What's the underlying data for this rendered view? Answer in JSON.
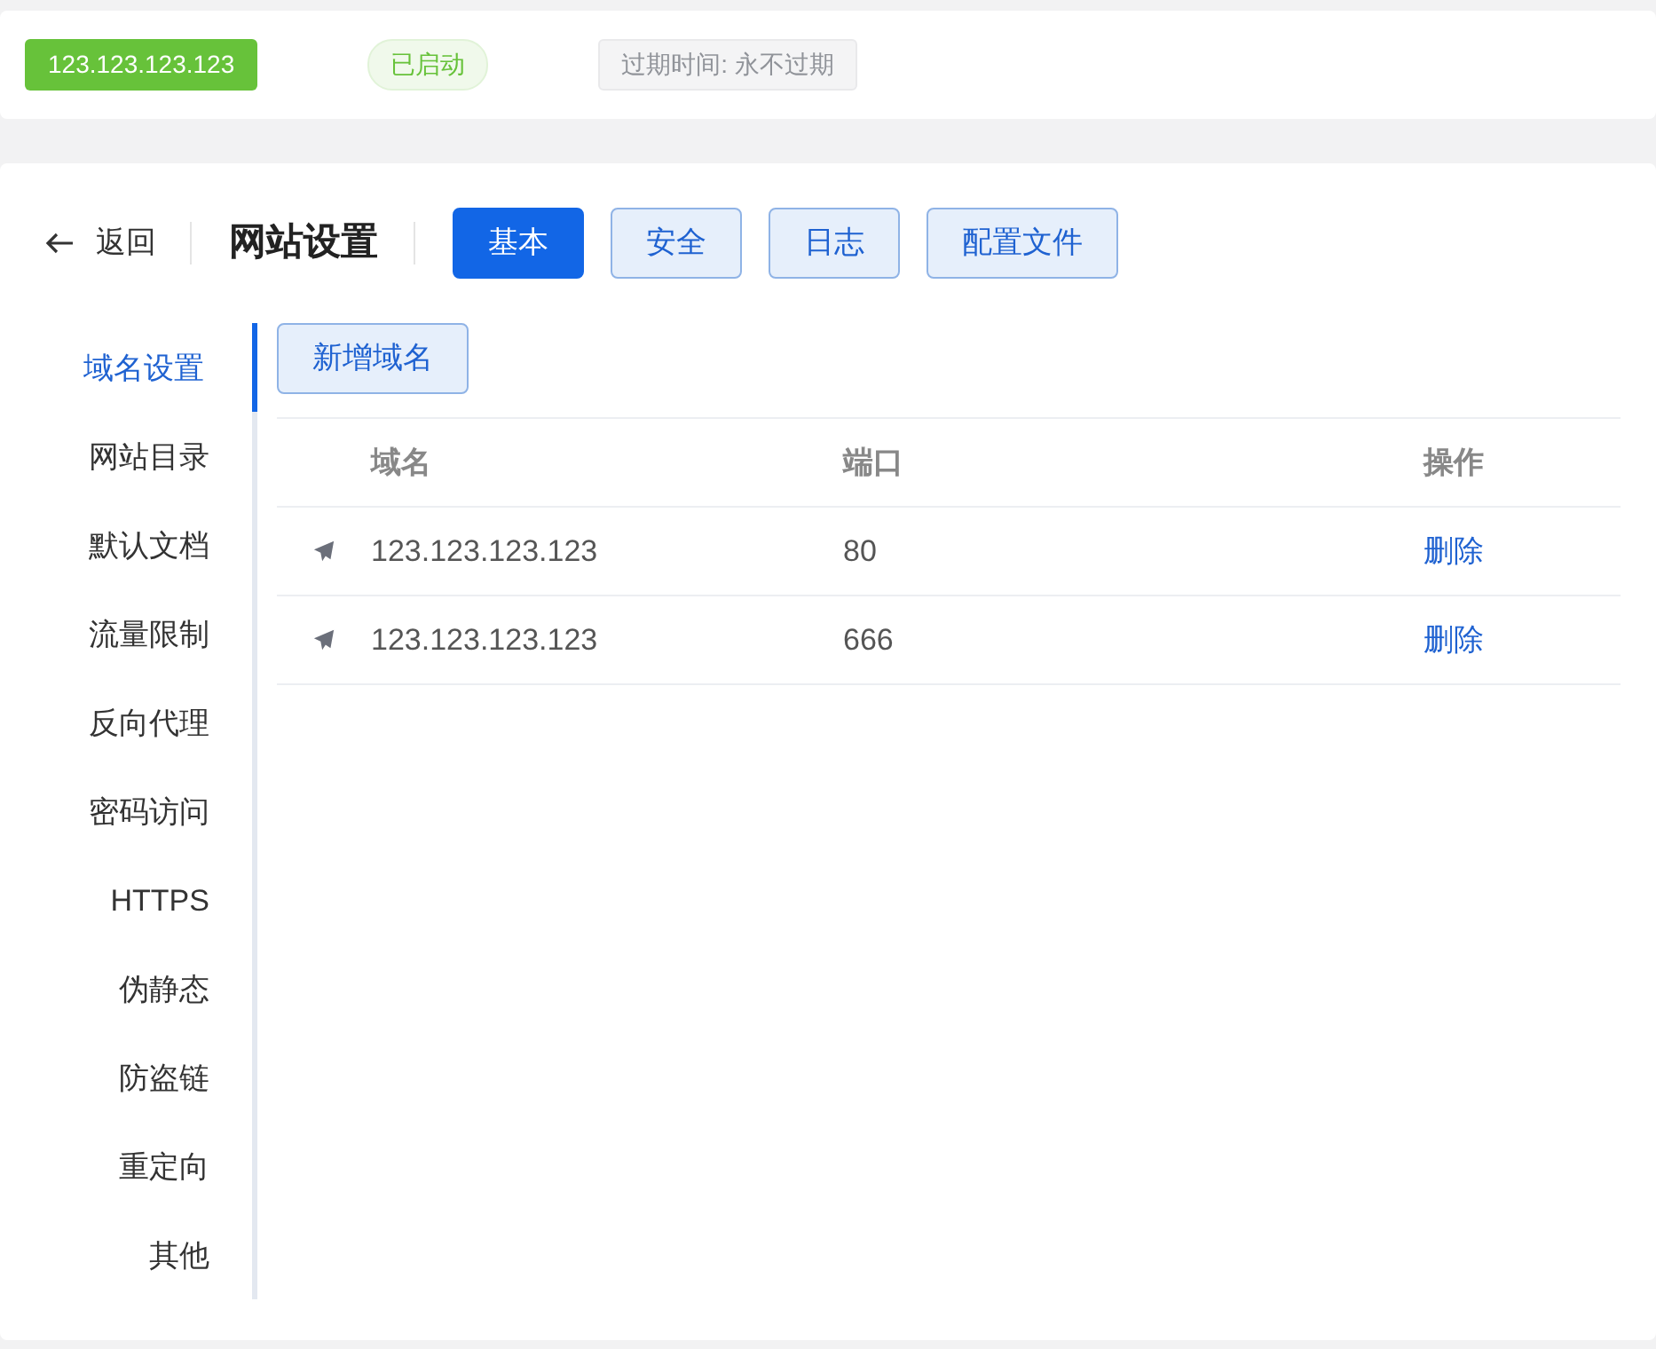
{
  "site_info": {
    "address": "123.123.123.123",
    "status": "已启动",
    "expiry": "过期时间: 永不过期"
  },
  "header": {
    "back": "返回",
    "title": "网站设置",
    "tabs": [
      {
        "label": "基本",
        "selected": true
      },
      {
        "label": "安全",
        "selected": false
      },
      {
        "label": "日志",
        "selected": false
      },
      {
        "label": "配置文件",
        "selected": false
      }
    ]
  },
  "sidebar": {
    "items": [
      {
        "label": "域名设置",
        "selected": true
      },
      {
        "label": "网站目录",
        "selected": false
      },
      {
        "label": "默认文档",
        "selected": false
      },
      {
        "label": "流量限制",
        "selected": false
      },
      {
        "label": "反向代理",
        "selected": false
      },
      {
        "label": "密码访问",
        "selected": false
      },
      {
        "label": "HTTPS",
        "selected": false
      },
      {
        "label": "伪静态",
        "selected": false
      },
      {
        "label": "防盗链",
        "selected": false
      },
      {
        "label": "重定向",
        "selected": false
      },
      {
        "label": "其他",
        "selected": false
      }
    ]
  },
  "add_button": "新增域名",
  "table": {
    "columns": [
      "域名",
      "端口",
      "操作"
    ],
    "rows": [
      {
        "domain": "123.123.123.123",
        "port": "80",
        "action": "删除"
      },
      {
        "domain": "123.123.123.123",
        "port": "666",
        "action": "删除"
      }
    ]
  }
}
